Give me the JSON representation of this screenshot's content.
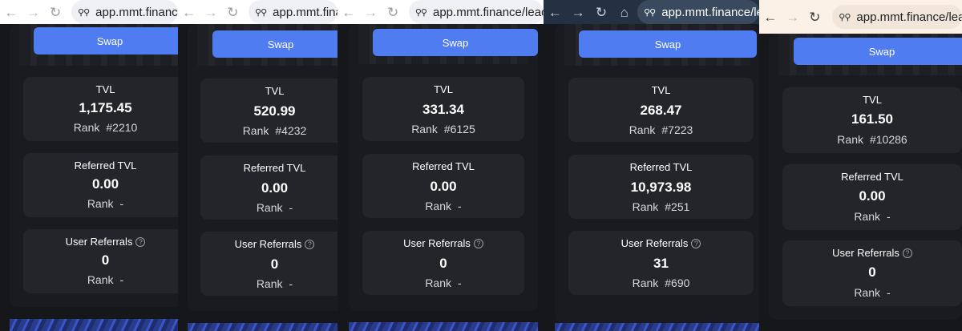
{
  "browser": {
    "nav": {
      "back": "←",
      "forward": "→",
      "reload": "↻",
      "home": "⌂"
    }
  },
  "panels": [
    {
      "url": "app.mmt.finance",
      "swap_label": "Swap",
      "stats": [
        {
          "label": "TVL",
          "value": "1,175.45",
          "rank_label": "Rank",
          "rank": "#2210"
        },
        {
          "label": "Referred TVL",
          "value": "0.00",
          "rank_label": "Rank",
          "rank": "-"
        },
        {
          "label": "User Referrals",
          "value": "0",
          "rank_label": "Rank",
          "rank": "-"
        }
      ]
    },
    {
      "url": "app.mmt.fina",
      "swap_label": "Swap",
      "stats": [
        {
          "label": "TVL",
          "value": "520.99",
          "rank_label": "Rank",
          "rank": "#4232"
        },
        {
          "label": "Referred TVL",
          "value": "0.00",
          "rank_label": "Rank",
          "rank": "-"
        },
        {
          "label": "User Referrals",
          "value": "0",
          "rank_label": "Rank",
          "rank": "-"
        }
      ]
    },
    {
      "url": "app.mmt.finance/leade",
      "swap_label": "Swap",
      "stats": [
        {
          "label": "TVL",
          "value": "331.34",
          "rank_label": "Rank",
          "rank": "#6125"
        },
        {
          "label": "Referred TVL",
          "value": "0.00",
          "rank_label": "Rank",
          "rank": "-"
        },
        {
          "label": "User Referrals",
          "value": "0",
          "rank_label": "Rank",
          "rank": "-"
        }
      ]
    },
    {
      "url": "app.mmt.finance/le",
      "swap_label": "Swap",
      "stats": [
        {
          "label": "TVL",
          "value": "268.47",
          "rank_label": "Rank",
          "rank": "#7223"
        },
        {
          "label": "Referred TVL",
          "value": "10,973.98",
          "rank_label": "Rank",
          "rank": "#251"
        },
        {
          "label": "User Referrals",
          "value": "31",
          "rank_label": "Rank",
          "rank": "#690"
        }
      ]
    },
    {
      "url": "app.mmt.finance/lead",
      "swap_label": "Swap",
      "stats": [
        {
          "label": "TVL",
          "value": "161.50",
          "rank_label": "Rank",
          "rank": "#10286"
        },
        {
          "label": "Referred TVL",
          "value": "0.00",
          "rank_label": "Rank",
          "rank": "-"
        },
        {
          "label": "User Referrals",
          "value": "0",
          "rank_label": "Rank",
          "rank": "-"
        }
      ]
    }
  ]
}
